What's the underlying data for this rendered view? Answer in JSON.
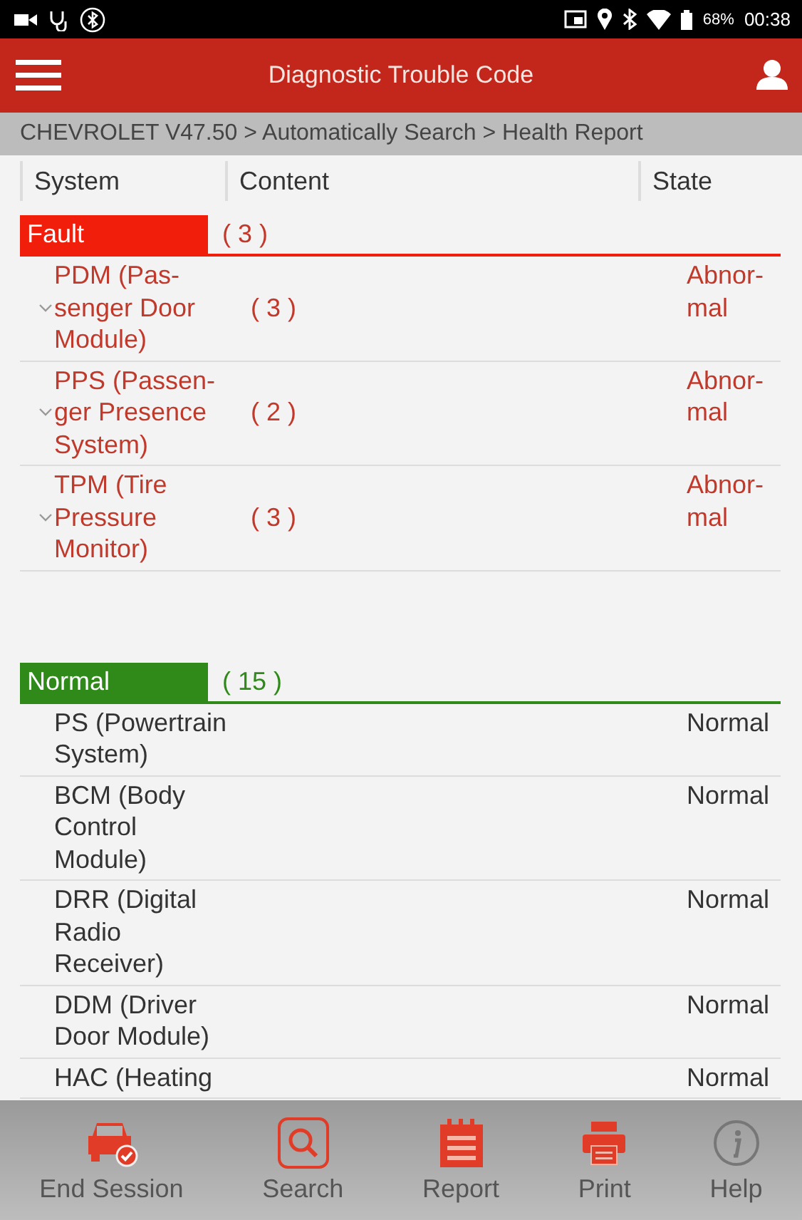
{
  "status_bar": {
    "battery": "68%",
    "time": "00:38"
  },
  "header": {
    "title": "Diagnostic Trouble Code"
  },
  "breadcrumb": "CHEVROLET V47.50 > Automatically Search > Health Report",
  "columns": [
    "System",
    "Content",
    "State"
  ],
  "groups": [
    {
      "kind": "fault",
      "label": "Fault",
      "count": "( 3 )",
      "rows": [
        {
          "system": "PDM (Pas-senger Door Module)",
          "content": "( 3 )",
          "state": "Abnor-mal",
          "expandable": true
        },
        {
          "system": "PPS (Passen-ger Presence System)",
          "content": "( 2 )",
          "state": "Abnor-mal",
          "expandable": true
        },
        {
          "system": "TPM (Tire Pressure Monitor)",
          "content": "( 3 )",
          "state": "Abnor-mal",
          "expandable": true
        }
      ]
    },
    {
      "kind": "normal",
      "label": "Normal",
      "count": "( 15 )",
      "rows": [
        {
          "system": "PS (Powertrain System)",
          "state": "Normal",
          "expandable": false
        },
        {
          "system": "BCM (Body Control Module)",
          "state": "Normal",
          "expandable": false
        },
        {
          "system": "DRR (Digital Radio Receiver)",
          "state": "Normal",
          "expandable": false
        },
        {
          "system": "DDM (Driver Door Module)",
          "state": "Normal",
          "expandable": false
        },
        {
          "system": "HAC (Heating",
          "state": "Normal",
          "expandable": false
        }
      ]
    }
  ],
  "toolbar": [
    {
      "kind": "end",
      "label": "End Session"
    },
    {
      "kind": "search",
      "label": "Search"
    },
    {
      "kind": "report",
      "label": "Report"
    },
    {
      "kind": "print",
      "label": "Print"
    },
    {
      "kind": "help",
      "label": "Help"
    }
  ]
}
